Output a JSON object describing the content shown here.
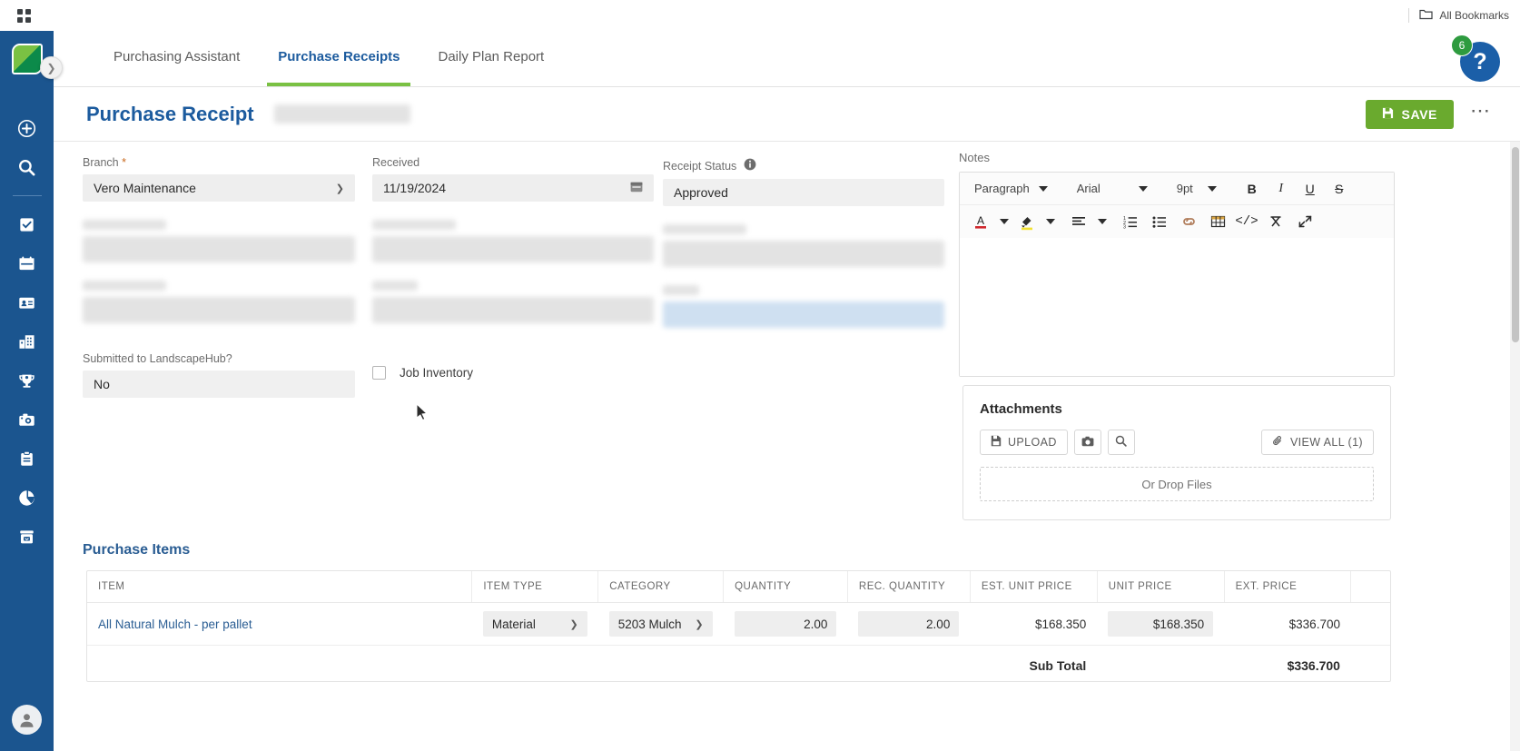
{
  "browser": {
    "apps_icon": "apps-grid-icon",
    "bookmarks_label": "All Bookmarks",
    "folder_icon": "folder-icon"
  },
  "rail": {
    "logo_icon": "leaf-logo-icon",
    "expand_icon": "chevron-right-icon",
    "items": [
      {
        "name": "add",
        "icon": "plus-circle-icon"
      },
      {
        "name": "search",
        "icon": "search-icon"
      },
      {
        "name": "tasks",
        "icon": "checklist-icon"
      },
      {
        "name": "calendar",
        "icon": "calendar-icon"
      },
      {
        "name": "contacts",
        "icon": "contact-card-icon"
      },
      {
        "name": "properties",
        "icon": "building-icon"
      },
      {
        "name": "awards",
        "icon": "trophy-icon"
      },
      {
        "name": "photos",
        "icon": "camera-icon"
      },
      {
        "name": "clipboard",
        "icon": "clipboard-icon"
      },
      {
        "name": "reports",
        "icon": "pie-chart-icon"
      },
      {
        "name": "inbox",
        "icon": "inbox-icon"
      }
    ],
    "avatar_icon": "user-avatar-icon"
  },
  "header": {
    "tabs": [
      {
        "label": "Purchasing Assistant",
        "active": false
      },
      {
        "label": "Purchase Receipts",
        "active": true
      },
      {
        "label": "Daily Plan Report",
        "active": false
      }
    ],
    "help_icon": "question-mark-icon",
    "help_badge": "6"
  },
  "page": {
    "title": "Purchase Receipt",
    "save_label": "SAVE",
    "save_icon": "save-disk-icon",
    "more_icon": "kebab-menu-icon",
    "accent_color": "#1c5b9e",
    "save_color": "#6aaa2e"
  },
  "form": {
    "branch": {
      "label": "Branch",
      "required": "*",
      "value": "Vero Maintenance",
      "caret_icon": "chevron-down-icon"
    },
    "received": {
      "label": "Received",
      "value": "11/19/2024",
      "icon": "calendar-icon"
    },
    "receipt_status": {
      "label": "Receipt Status",
      "info_icon": "info-icon",
      "value": "Approved"
    },
    "submitted": {
      "label": "Submitted to LandscapeHub?",
      "value": "No"
    },
    "job_inventory": {
      "label": "Job Inventory",
      "checked": false
    }
  },
  "notes": {
    "label": "Notes",
    "toolbar_row1": [
      {
        "kind": "select",
        "label": "Paragraph",
        "name": "paragraph-format-select"
      },
      {
        "kind": "select",
        "label": "Arial",
        "name": "font-family-select"
      },
      {
        "kind": "select",
        "label": "9pt",
        "name": "font-size-select"
      },
      {
        "kind": "btn",
        "label": "B",
        "name": "bold-icon"
      },
      {
        "kind": "btn",
        "label": "I",
        "name": "italic-icon"
      },
      {
        "kind": "btn",
        "label": "U",
        "name": "underline-icon"
      },
      {
        "kind": "btn",
        "label": "S",
        "name": "strikethrough-icon"
      }
    ],
    "toolbar_row2": [
      {
        "name": "text-color-icon",
        "label": "A"
      },
      {
        "name": "highlight-color-icon",
        "label": "fill"
      },
      {
        "name": "align-left-icon",
        "label": "align"
      },
      {
        "name": "numbered-list-icon",
        "label": "ol"
      },
      {
        "name": "bulleted-list-icon",
        "label": "ul"
      },
      {
        "name": "link-icon",
        "label": "link"
      },
      {
        "name": "table-icon",
        "label": "table"
      },
      {
        "name": "source-code-icon",
        "label": "code"
      },
      {
        "name": "clear-formatting-icon",
        "label": "clear"
      },
      {
        "name": "fullscreen-icon",
        "label": "expand"
      }
    ],
    "body_value": ""
  },
  "attachments": {
    "title": "Attachments",
    "upload_label": "UPLOAD",
    "upload_icon": "file-upload-icon",
    "camera_icon": "camera-icon",
    "search_icon": "search-icon",
    "view_all_label": "VIEW ALL (1)",
    "link_icon": "paperclip-icon",
    "drop_label": "Or Drop Files"
  },
  "purchase_items": {
    "title": "Purchase Items",
    "columns": [
      "ITEM",
      "ITEM TYPE",
      "CATEGORY",
      "QUANTITY",
      "REC. QUANTITY",
      "EST. UNIT PRICE",
      "UNIT PRICE",
      "EXT. PRICE"
    ],
    "rows": [
      {
        "item": "All Natural Mulch - per pallet",
        "item_type": "Material",
        "category": "5203 Mulch",
        "quantity": "2.00",
        "rec_quantity": "2.00",
        "est_unit_price": "$168.350",
        "unit_price": "$168.350",
        "ext_price": "$336.700"
      }
    ],
    "subtotal_label": "Sub Total",
    "subtotal_value": "$336.700"
  }
}
